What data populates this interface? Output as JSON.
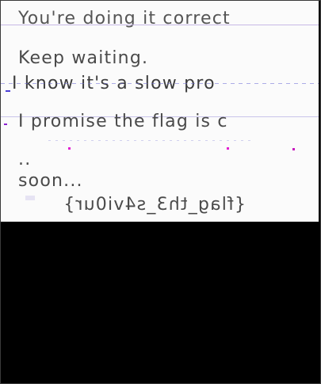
{
  "lines": {
    "line1": "You're doing it correct",
    "line2": "Keep waiting.",
    "line3": "I know it's a slow pro",
    "line4": "I promise the flag is c",
    "line5": "..",
    "line6": "soon...",
    "line7": "{flag_th3_s4vi0ur}"
  }
}
